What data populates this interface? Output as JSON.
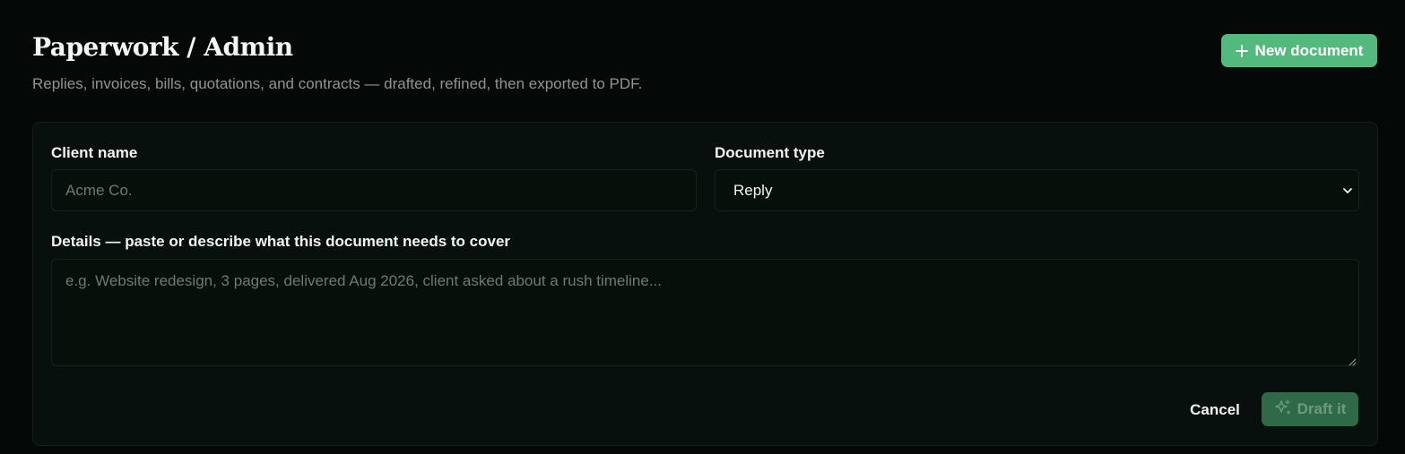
{
  "header": {
    "title": "Paperwork / Admin",
    "subtitle": "Replies, invoices, bills, quotations, and contracts — drafted, refined, then exported to PDF.",
    "new_document_label": "New document",
    "new_document_icon": "plus-icon"
  },
  "form": {
    "client_name": {
      "label": "Client name",
      "value": "",
      "placeholder": "Acme Co."
    },
    "document_type": {
      "label": "Document type",
      "selected": "Reply",
      "icon": "chevron-down-icon"
    },
    "details": {
      "label": "Details — paste or describe what this document needs to cover",
      "value": "",
      "placeholder": "e.g. Website redesign, 3 pages, delivered Aug 2026, client asked about a rush timeline..."
    },
    "cancel_label": "Cancel",
    "draft_label": "Draft it",
    "draft_icon": "sparkles-icon",
    "draft_disabled": true
  },
  "colors": {
    "background": "#040806",
    "card": "#07100c",
    "accent": "#54b97d",
    "accent_disabled": "#2f6a48",
    "muted_text": "#8d968f"
  }
}
